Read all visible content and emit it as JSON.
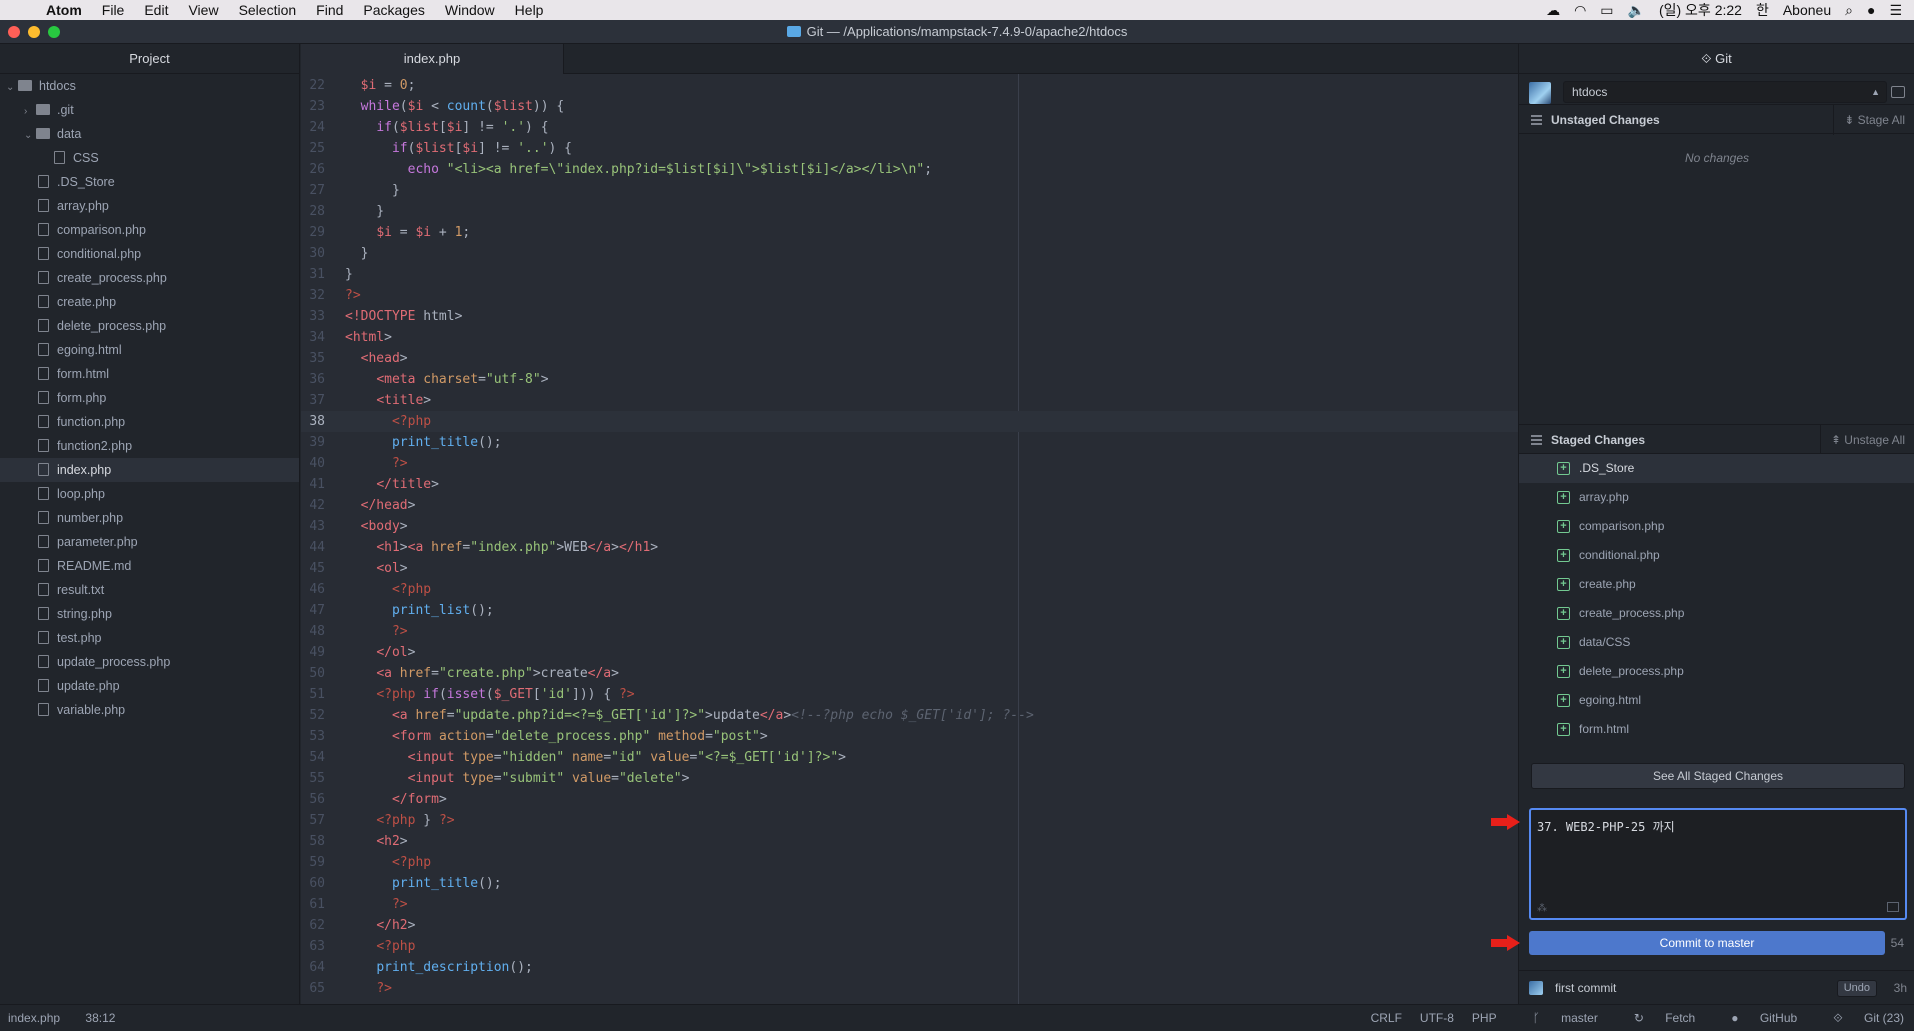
{
  "menubar": {
    "app": "Atom",
    "items": [
      "File",
      "Edit",
      "View",
      "Selection",
      "Find",
      "Packages",
      "Window",
      "Help"
    ],
    "datetime": "(일) 오후 2:22",
    "input_source": "한",
    "user": "Aboneu"
  },
  "window": {
    "title": "Git — /Applications/mampstack-7.4.9-0/apache2/htdocs"
  },
  "tree": {
    "title": "Project",
    "root": "htdocs",
    "folders": {
      "git": ".git",
      "data": "data",
      "css": "CSS"
    },
    "files": [
      ".DS_Store",
      "array.php",
      "comparison.php",
      "conditional.php",
      "create_process.php",
      "create.php",
      "delete_process.php",
      "egoing.html",
      "form.html",
      "form.php",
      "function.php",
      "function2.php",
      "index.php",
      "loop.php",
      "number.php",
      "parameter.php",
      "README.md",
      "result.txt",
      "string.php",
      "test.php",
      "update_process.php",
      "update.php",
      "variable.php"
    ]
  },
  "editor": {
    "tab": "index.php",
    "line_numbers": [
      "22",
      "23",
      "24",
      "25",
      "26",
      "27",
      "28",
      "29",
      "30",
      "31",
      "32",
      "33",
      "34",
      "35",
      "36",
      "37",
      "38",
      "39",
      "40",
      "41",
      "42",
      "43",
      "44",
      "45",
      "46",
      "47",
      "48",
      "49",
      "50",
      "51",
      "52",
      "53",
      "54",
      "55",
      "56",
      "57",
      "58",
      "59",
      "60",
      "61",
      "62",
      "63",
      "64",
      "65"
    ],
    "lines": [
      "  $i = 0;",
      "  while($i < count($list)) {",
      "    if($list[$i] != '.') {",
      "      if($list[$i] != '..') {",
      "        echo \"<li><a href=\\\"index.php?id=$list[$i]\\\">$list[$i]</a></li>\\n\";",
      "      }",
      "    }",
      "    $i = $i + 1;",
      "  }",
      "}",
      "?>",
      "<!DOCTYPE html>",
      "<html>",
      "  <head>",
      "    <meta charset=\"utf-8\">",
      "    <title>",
      "      <?php",
      "      print_title();",
      "      ?>",
      "    </title>",
      "  </head>",
      "  <body>",
      "    <h1><a href=\"index.php\">WEB</a></h1>",
      "    <ol>",
      "      <?php",
      "      print_list();",
      "      ?>",
      "    </ol>",
      "    <a href=\"create.php\">create</a>",
      "    <?php if(isset($_GET['id'])) { ?>",
      "      <a href=\"update.php?id=<?=$_GET['id']?>\">update</a><!--?php echo $_GET['id']; ?-->",
      "      <form action=\"delete_process.php\" method=\"post\">",
      "        <input type=\"hidden\" name=\"id\" value=\"<?=$_GET['id']?>\">",
      "        <input type=\"submit\" value=\"delete\">",
      "      </form>",
      "    <?php } ?>",
      "    <h2>",
      "      <?php",
      "      print_title();",
      "      ?>",
      "    </h2>",
      "    <?php",
      "    print_description();",
      "    ?>"
    ],
    "cursor_line": "38"
  },
  "git": {
    "title": "Git",
    "repo": "htdocs",
    "unstaged_title": "Unstaged Changes",
    "stage_all": "Stage All",
    "no_changes": "No changes",
    "staged_title": "Staged Changes",
    "unstage_all": "Unstage All",
    "staged_files": [
      ".DS_Store",
      "array.php",
      "comparison.php",
      "conditional.php",
      "create.php",
      "create_process.php",
      "data/CSS",
      "delete_process.php",
      "egoing.html",
      "form.html"
    ],
    "see_all": "See All Staged Changes",
    "commit_message": "37. WEB2-PHP-25 까지",
    "commit_button": "Commit to master",
    "commit_count": "54",
    "recent_commit": "first commit",
    "undo": "Undo",
    "recent_time": "3h"
  },
  "statusbar": {
    "file": "index.php",
    "cursor": "38:12",
    "line_ending": "CRLF",
    "encoding": "UTF-8",
    "grammar": "PHP",
    "branch": "master",
    "fetch": "Fetch",
    "github": "GitHub",
    "git": "Git (23)"
  }
}
